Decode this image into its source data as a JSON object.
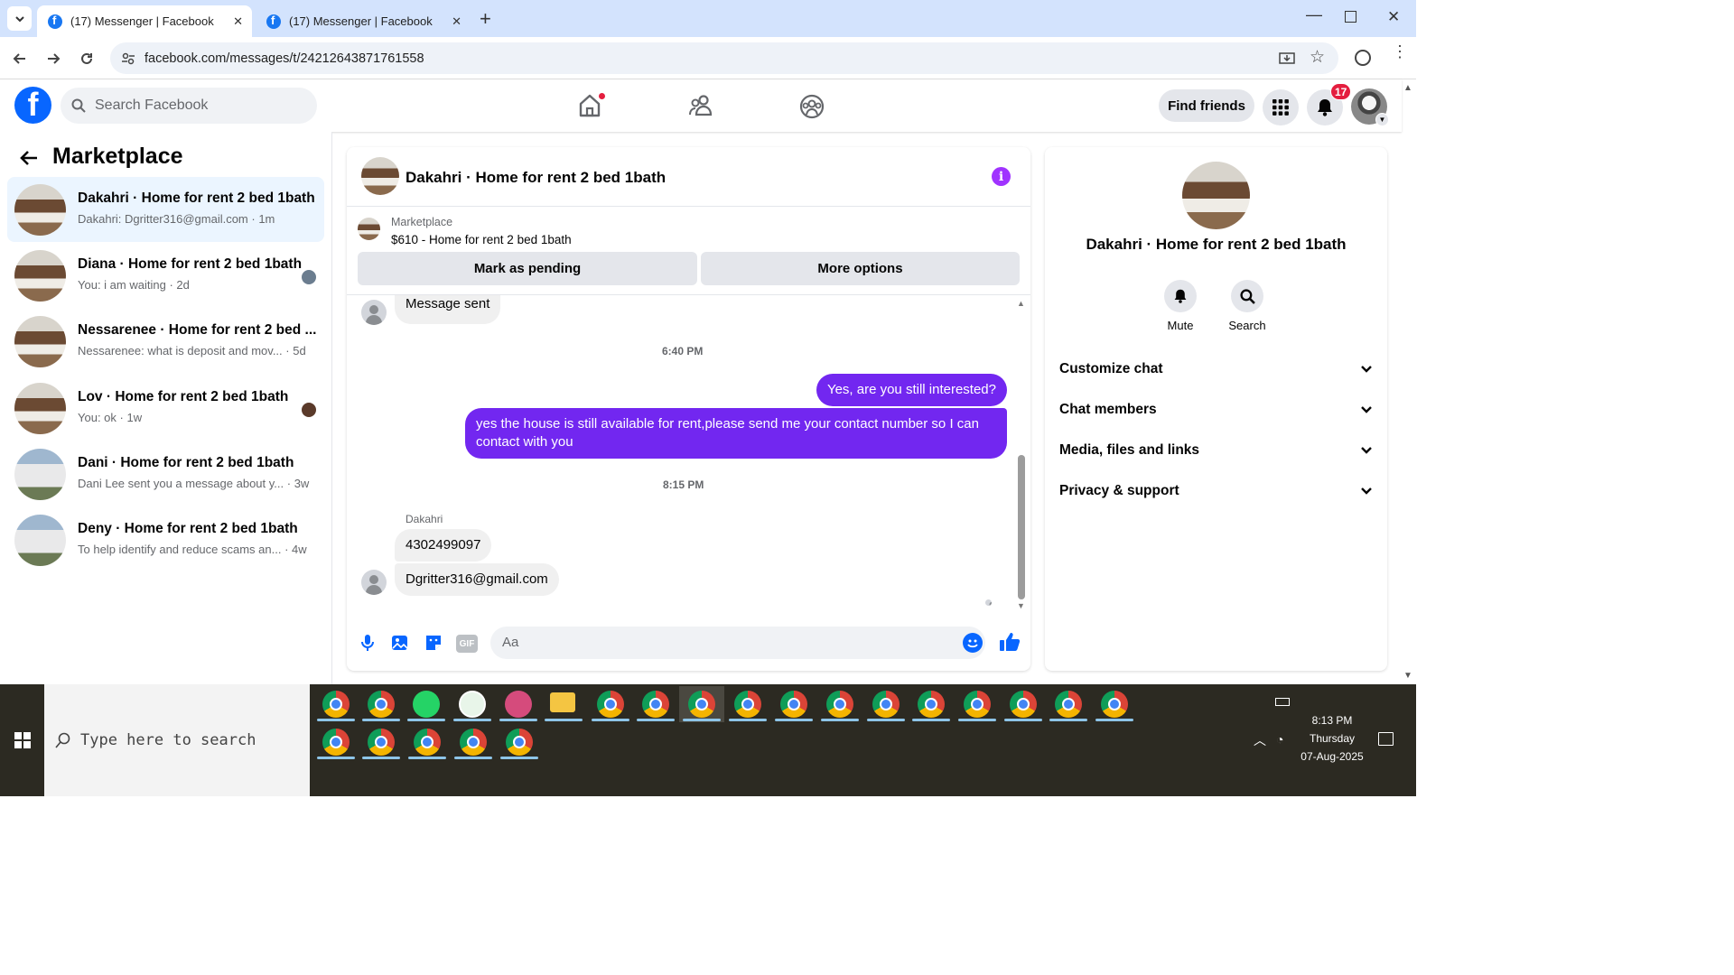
{
  "browser": {
    "tabs": [
      {
        "title": "(17) Messenger | Facebook",
        "active": true
      },
      {
        "title": "(17) Messenger | Facebook",
        "active": false
      }
    ],
    "url": "facebook.com/messages/t/24212643871761558"
  },
  "header": {
    "search_placeholder": "Search Facebook",
    "find_friends": "Find friends",
    "notification_count": "17"
  },
  "sidebar": {
    "title": "Marketplace",
    "conversations": [
      {
        "title": "Dakahri · Home for rent 2 bed 1bath",
        "snippet": "Dakahri: Dgritter316@gmail.com",
        "time": "· 1m",
        "selected": true
      },
      {
        "title": "Diana · Home for rent 2 bed 1bath",
        "snippet": "You: i am waiting",
        "time": "· 2d"
      },
      {
        "title": "Nessarenee · Home for rent 2 bed ...",
        "snippet": "Nessarenee: what is deposit and mov...",
        "time": "· 5d"
      },
      {
        "title": "Lov · Home for rent 2 bed 1bath",
        "snippet": "You: ok",
        "time": "· 1w"
      },
      {
        "title": "Dani · Home for rent 2 bed 1bath",
        "snippet": "Dani Lee sent you a message about y...",
        "time": "· 3w"
      },
      {
        "title": "Deny · Home for rent 2 bed 1bath",
        "snippet": "To help identify and reduce scams an...",
        "time": "· 4w"
      }
    ]
  },
  "chat": {
    "title": "Dakahri · Home for rent 2 bed 1bath",
    "listing_label": "Marketplace",
    "listing_price": "$610 - Home for rent 2 bed 1bath",
    "mark_pending": "Mark as pending",
    "more_options": "More options",
    "messages": {
      "sent_status": "Message sent",
      "time1": "6:40 PM",
      "out1": "Yes, are you still interested?",
      "out2": "yes the house is still available for rent,please send me your contact number so I can contact with you",
      "time2": "8:15 PM",
      "sender": "Dakahri",
      "in1": "4302499097",
      "in2": "Dgritter316@gmail.com"
    },
    "composer_placeholder": "Aa"
  },
  "details": {
    "title": "Dakahri · Home for rent 2 bed 1bath",
    "mute": "Mute",
    "search": "Search",
    "sections": [
      "Customize chat",
      "Chat members",
      "Media, files and links",
      "Privacy & support"
    ]
  },
  "taskbar": {
    "search_placeholder": "Type here to search",
    "time": "8:13 PM",
    "day": "Thursday",
    "date": "07-Aug-2025"
  },
  "colors": {
    "accent": "#7227f0",
    "fb_blue": "#0866ff"
  }
}
